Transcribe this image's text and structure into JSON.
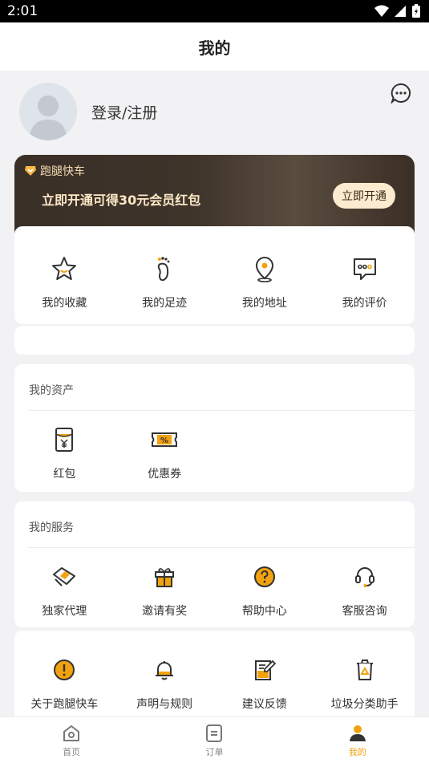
{
  "status_bar": {
    "time": "2:01"
  },
  "header": {
    "title": "我的"
  },
  "profile": {
    "login_label": "登录/注册"
  },
  "vip": {
    "badge": "跑腿快车",
    "promo": "立即开通可得30元会员红包",
    "button": "立即开通"
  },
  "quick_links": [
    {
      "label": "我的收藏",
      "icon": "star-icon"
    },
    {
      "label": "我的足迹",
      "icon": "footprint-icon"
    },
    {
      "label": "我的地址",
      "icon": "location-pin-icon"
    },
    {
      "label": "我的评价",
      "icon": "comment-icon"
    }
  ],
  "assets": {
    "title": "我的资产",
    "items": [
      {
        "label": "红包",
        "icon": "red-packet-icon"
      },
      {
        "label": "优惠券",
        "icon": "coupon-icon"
      }
    ]
  },
  "services": {
    "title": "我的服务",
    "row1": [
      {
        "label": "独家代理",
        "icon": "agency-icon"
      },
      {
        "label": "邀请有奖",
        "icon": "gift-icon"
      },
      {
        "label": "帮助中心",
        "icon": "help-icon"
      },
      {
        "label": "客服咨询",
        "icon": "headset-icon"
      }
    ],
    "row2": [
      {
        "label": "关于跑腿快车",
        "icon": "info-icon"
      },
      {
        "label": "声明与规则",
        "icon": "bell-icon"
      },
      {
        "label": "建议反馈",
        "icon": "edit-icon"
      },
      {
        "label": "垃圾分类助手",
        "icon": "recycle-bin-icon"
      }
    ]
  },
  "tabs": [
    {
      "label": "首页",
      "icon": "home-icon",
      "active": false
    },
    {
      "label": "订单",
      "icon": "order-icon",
      "active": false
    },
    {
      "label": "我的",
      "icon": "user-icon",
      "active": true
    }
  ],
  "colors": {
    "accent": "#f2a20f",
    "vip_bg": "#3a2f27",
    "vip_text": "#fbe8c6"
  }
}
